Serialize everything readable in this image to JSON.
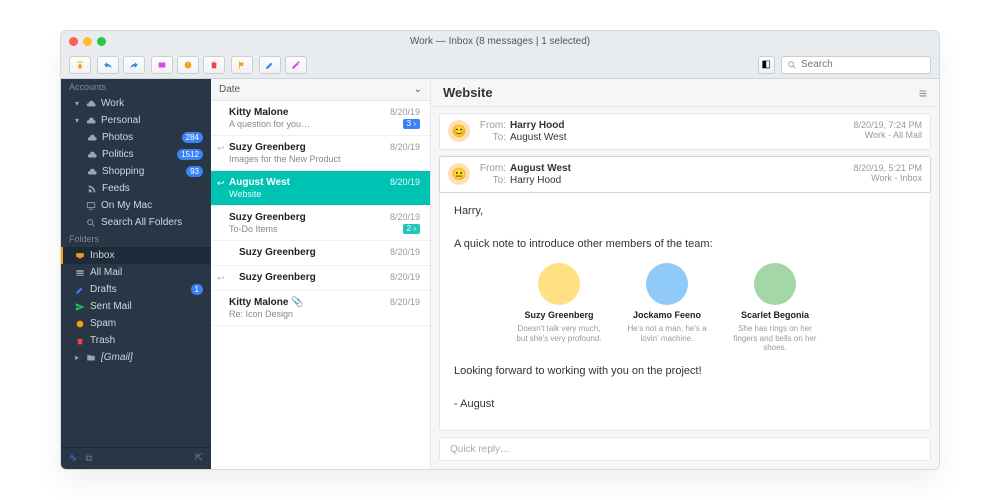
{
  "window_title": "Work — Inbox (8 messages | 1 selected)",
  "search": {
    "placeholder": "Search"
  },
  "sidebar": {
    "section_accounts": "Accounts",
    "section_folders": "Folders",
    "accounts": [
      {
        "name": "Work",
        "expanded": true
      },
      {
        "name": "Personal",
        "expanded": true,
        "children": [
          {
            "name": "Photos",
            "badge": "284"
          },
          {
            "name": "Politics",
            "badge": "1512"
          },
          {
            "name": "Shopping",
            "badge": "93"
          },
          {
            "name": "Feeds",
            "badge": ""
          }
        ]
      },
      {
        "name": "On My Mac"
      },
      {
        "name": "Search All Folders"
      }
    ],
    "folders": [
      {
        "name": "Inbox",
        "selected": true
      },
      {
        "name": "All Mail"
      },
      {
        "name": "Drafts",
        "badge": "1"
      },
      {
        "name": "Sent Mail"
      },
      {
        "name": "Spam"
      },
      {
        "name": "Trash"
      }
    ],
    "gmail_label": "[Gmail]"
  },
  "list_header": "Date",
  "messages": [
    {
      "sender": "Kitty Malone",
      "subject": "A question for you…",
      "date": "8/20/19",
      "badge": "3",
      "badge_color": "#3b82f6"
    },
    {
      "sender": "Suzy Greenberg",
      "subject": "Images for the New Product",
      "date": "8/20/19",
      "reply": true
    },
    {
      "sender": "August West",
      "subject": "Website",
      "date": "8/20/19",
      "selected": true,
      "reply": true
    },
    {
      "sender": "Suzy Greenberg",
      "subject": "To-Do Items",
      "date": "8/20/19",
      "badge": "2",
      "badge_color": "#22c7b8"
    },
    {
      "sender": "Suzy Greenberg",
      "subject": "",
      "date": "8/20/19",
      "indent": true
    },
    {
      "sender": "Suzy Greenberg",
      "subject": "",
      "date": "8/20/19",
      "indent": true,
      "reply": true
    },
    {
      "sender": "Kitty Malone",
      "subject": "Re: Icon Design",
      "date": "8/20/19",
      "attach": true
    }
  ],
  "reader": {
    "title": "Website",
    "headers": [
      {
        "from_label": "From:",
        "from": "Harry Hood",
        "to_label": "To:",
        "to": "August West",
        "date": "8/20/19, 7:24 PM",
        "meta": "Work - All Mail",
        "avatar": "😊"
      },
      {
        "from_label": "From:",
        "from": "August West",
        "to_label": "To:",
        "to": "Harry Hood",
        "date": "8/20/19, 5:21 PM",
        "meta": "Work - Inbox",
        "avatar": "😐",
        "active": true
      }
    ],
    "body_greeting": "Harry,",
    "body_intro": "A quick note to introduce other members of the team:",
    "team": [
      {
        "name": "Suzy Greenberg",
        "bio": "Doesn't talk very much, but she's very profound."
      },
      {
        "name": "Jockamo Feeno",
        "bio": "He's not a man, he's a lovin' machine."
      },
      {
        "name": "Scarlet Begonia",
        "bio": "She has rings on her fingers and bells on her shoes."
      }
    ],
    "body_closing1": "Looking forward to working with you on the project!",
    "body_closing2": "- August",
    "quick_reply": "Quick reply…"
  }
}
